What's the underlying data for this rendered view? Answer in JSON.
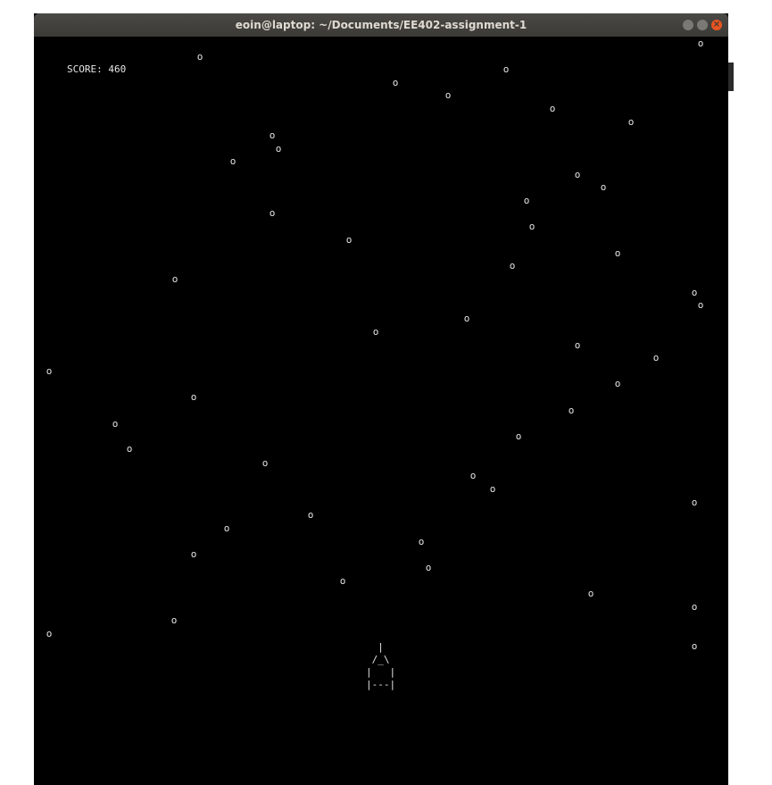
{
  "window": {
    "title": "eoin@laptop: ~/Documents/EE402-assignment-1",
    "close_glyph": "×"
  },
  "game": {
    "score_text": "SCORE: 460",
    "obstacle_glyph": "o",
    "ship_art": "  |\n /_\\\n|   |\n|---|"
  }
}
